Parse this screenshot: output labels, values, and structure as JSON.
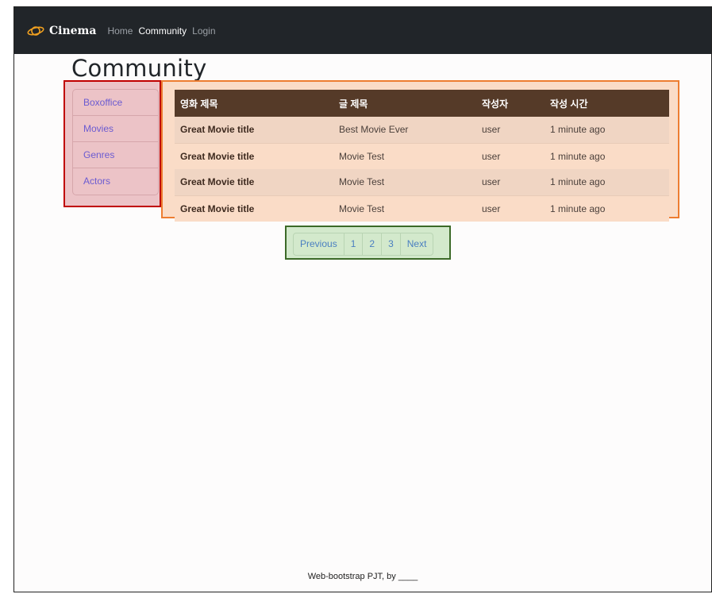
{
  "navbar": {
    "brand": "Cinema",
    "links": [
      {
        "label": "Home",
        "active": false
      },
      {
        "label": "Community",
        "active": true
      },
      {
        "label": "Login",
        "active": false
      }
    ]
  },
  "page": {
    "title": "Community"
  },
  "sidebar": {
    "items": [
      {
        "label": "Boxoffice"
      },
      {
        "label": "Movies"
      },
      {
        "label": "Genres"
      },
      {
        "label": "Actors"
      }
    ]
  },
  "table": {
    "headers": [
      "영화 제목",
      "글 제목",
      "작성자",
      "작성 시간"
    ],
    "rows": [
      {
        "movie": "Great Movie title",
        "post": "Best Movie Ever",
        "author": "user",
        "time": "1 minute ago"
      },
      {
        "movie": "Great Movie title",
        "post": "Movie Test",
        "author": "user",
        "time": "1 minute ago"
      },
      {
        "movie": "Great Movie title",
        "post": "Movie Test",
        "author": "user",
        "time": "1 minute ago"
      },
      {
        "movie": "Great Movie title",
        "post": "Movie Test",
        "author": "user",
        "time": "1 minute ago"
      }
    ]
  },
  "pagination": {
    "previous": "Previous",
    "pages": [
      "1",
      "2",
      "3"
    ],
    "next": "Next"
  },
  "footer": {
    "text": "Web-bootstrap PJT, by ____"
  },
  "colors": {
    "navbar_bg": "#212529",
    "table_header_bg": "#553a28",
    "sidebar_highlight": "#c00000",
    "table_highlight": "#ed7d31",
    "pagination_highlight": "#3c6a28"
  }
}
